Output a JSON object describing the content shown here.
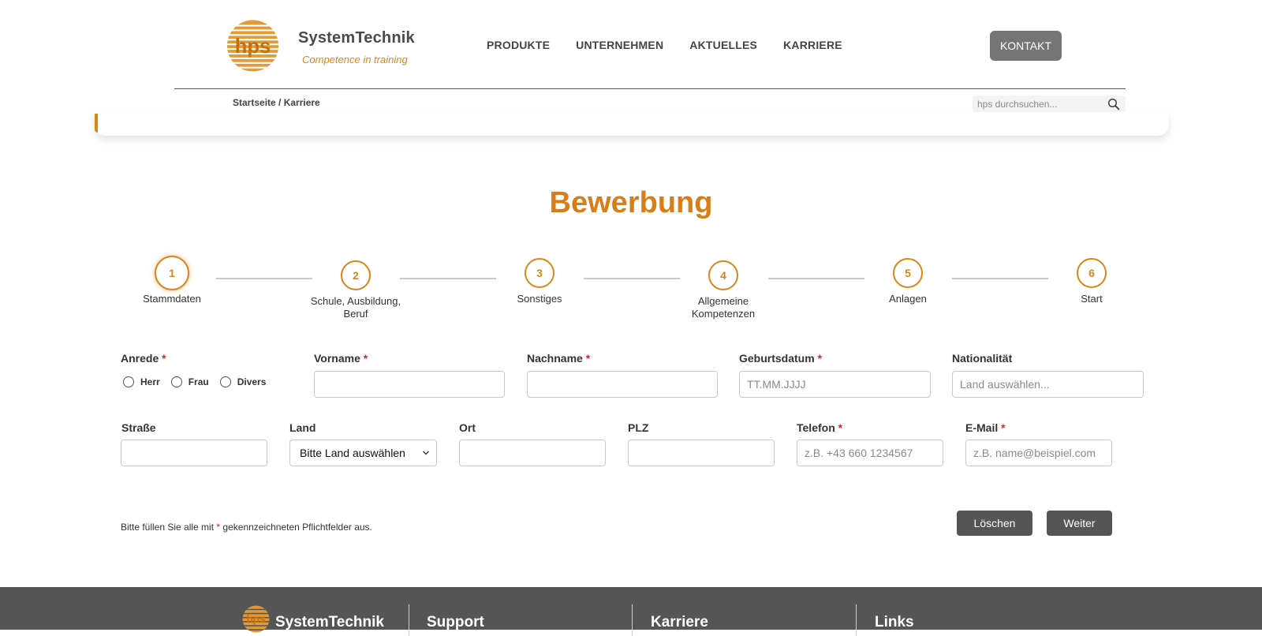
{
  "brand": {
    "name": "SystemTechnik",
    "tagline": "Competence in training",
    "logo_text": "hps",
    "accent_color": "#d98619"
  },
  "nav": {
    "items": [
      {
        "label": "PRODUKTE"
      },
      {
        "label": "UNTERNEHMEN"
      },
      {
        "label": "AKTUELLES"
      },
      {
        "label": "KARRIERE"
      }
    ],
    "contact_label": "KONTAKT"
  },
  "breadcrumb": "Startseite / Karriere",
  "search": {
    "placeholder": "hps durchsuchen...",
    "icon": "search-icon"
  },
  "page_title": "Bewerbung",
  "stepper": {
    "active_step": 1,
    "steps": [
      {
        "number": "1",
        "label": "Stammdaten"
      },
      {
        "number": "2",
        "label": "Schule, Ausbildung, Beruf"
      },
      {
        "number": "3",
        "label": "Sonstiges"
      },
      {
        "number": "4",
        "label": "Allgemeine Kompetenzen"
      },
      {
        "number": "5",
        "label": "Anlagen"
      },
      {
        "number": "6",
        "label": "Start"
      }
    ]
  },
  "form": {
    "required_marker": "*",
    "anrede": {
      "label": "Anrede",
      "options": [
        "Herr",
        "Frau",
        "Divers"
      ]
    },
    "vorname": {
      "label": "Vorname",
      "value": ""
    },
    "nachname": {
      "label": "Nachname",
      "value": ""
    },
    "geburtsdatum": {
      "label": "Geburtsdatum",
      "placeholder": "TT.MM.JJJJ"
    },
    "nationalitaet": {
      "label": "Nationalität",
      "placeholder": "Land auswählen..."
    },
    "strasse": {
      "label": "Straße",
      "value": ""
    },
    "land": {
      "label": "Land",
      "selected": "Bitte Land auswählen"
    },
    "ort": {
      "label": "Ort",
      "value": ""
    },
    "plz": {
      "label": "PLZ",
      "value": ""
    },
    "telefon": {
      "label": "Telefon",
      "placeholder": "z.B. +43 660 1234567"
    },
    "email": {
      "label": "E-Mail",
      "placeholder": "z.B. name@beispiel.com"
    },
    "hint_before": "Bitte füllen Sie alle mit",
    "hint_after": "gekennzeichneten Pflichtfelder aus.",
    "delete_label": "Löschen",
    "next_label": "Weiter"
  },
  "footer": {
    "brand": "SystemTechnik",
    "logo_text": "hps",
    "columns": [
      "Support",
      "Karriere",
      "Links"
    ]
  }
}
